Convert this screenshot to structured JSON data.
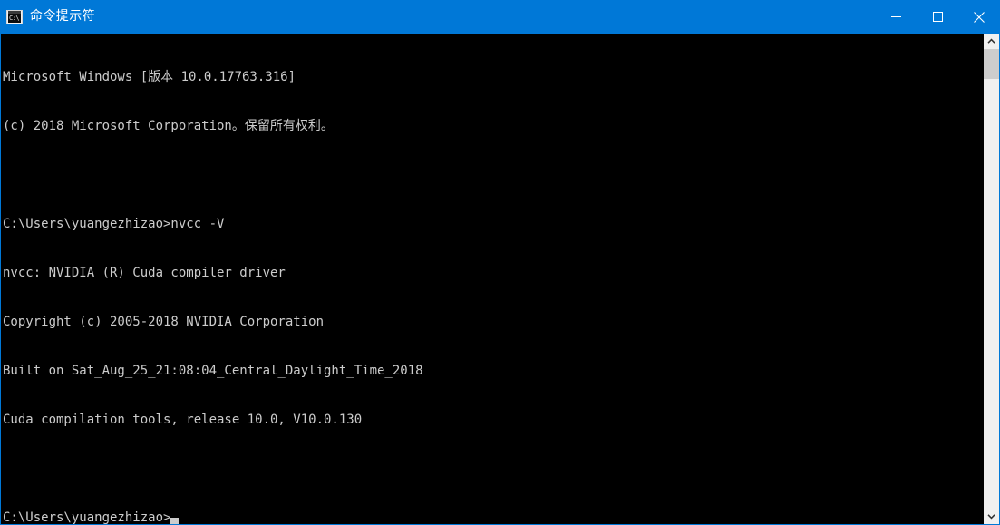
{
  "window": {
    "title": "命令提示符",
    "icon": "cmd-console-icon",
    "icon_text": "C:\\",
    "accent_color": "#0078d7",
    "background_color": "#000000",
    "text_color": "#cccccc",
    "controls": {
      "minimize": "minimize-icon",
      "maximize": "maximize-icon",
      "close": "close-icon"
    }
  },
  "console": {
    "lines": [
      "Microsoft Windows [版本 10.0.17763.316]",
      "(c) 2018 Microsoft Corporation。保留所有权利。",
      "",
      "C:\\Users\\yuangezhizao>nvcc -V",
      "nvcc: NVIDIA (R) Cuda compiler driver",
      "Copyright (c) 2005-2018 NVIDIA Corporation",
      "Built on Sat_Aug_25_21:08:04_Central_Daylight_Time_2018",
      "Cuda compilation tools, release 10.0, V10.0.130",
      ""
    ],
    "prompt": "C:\\Users\\yuangezhizao>",
    "cursor": "block-cursor"
  },
  "scrollbar": {
    "up_arrow": "chevron-up-icon",
    "down_arrow": "chevron-down-icon",
    "thumb": "scrollbar-thumb",
    "track_color": "#f0f0f0",
    "thumb_color": "#cdcdcd"
  }
}
